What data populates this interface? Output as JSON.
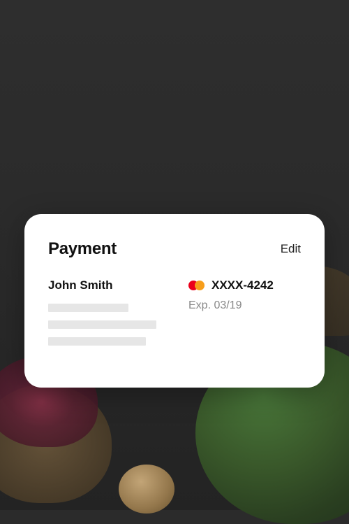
{
  "card": {
    "title": "Payment",
    "edit_label": "Edit",
    "name": "John Smith",
    "brand_icon": "mastercard-icon",
    "masked_number": "XXXX-4242",
    "expiry_label": "Exp. 03/19"
  }
}
